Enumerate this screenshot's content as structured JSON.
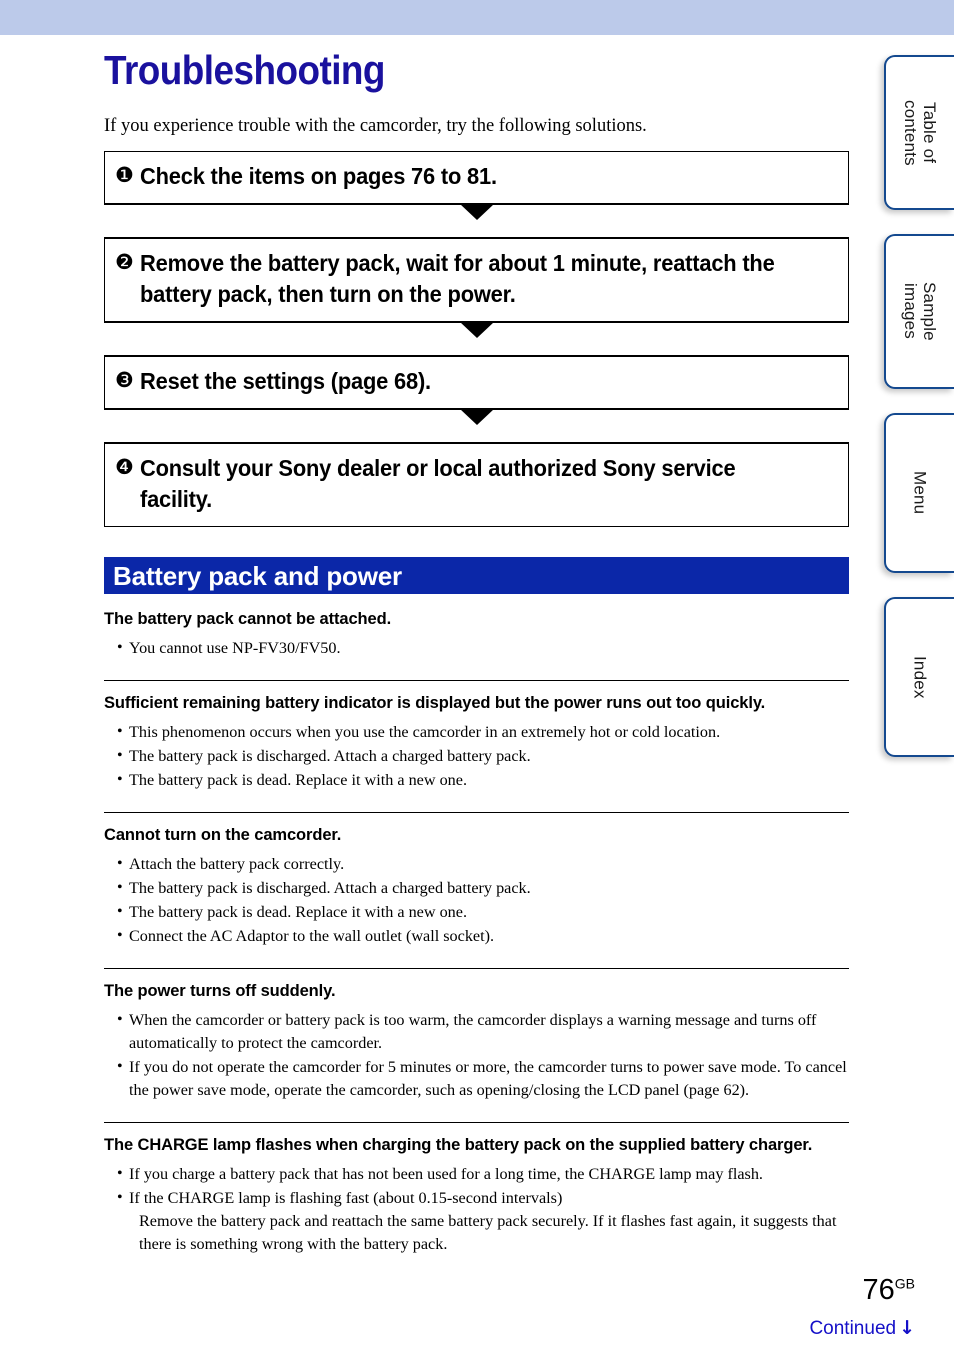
{
  "top_band_color": "#bccaea",
  "title_color": "#1a119e",
  "banner_color": "#0b27a8",
  "link_color": "#1510c8",
  "header": {
    "title": "Troubleshooting",
    "intro": "If you experience trouble with the camcorder, try the following solutions."
  },
  "steps": [
    {
      "num": "❶",
      "text": "Check the items on pages 76 to 81."
    },
    {
      "num": "❷",
      "text": "Remove the battery pack, wait for about 1 minute, reattach the battery pack, then turn on the power."
    },
    {
      "num": "❸",
      "text": "Reset the settings (page 68)."
    },
    {
      "num": "❹",
      "text": "Consult your Sony dealer or local authorized Sony service facility."
    }
  ],
  "section": {
    "banner_label": "Battery pack and power"
  },
  "qa_blocks": [
    {
      "heading": "The battery pack cannot be attached.",
      "items": [
        {
          "text": "You cannot use NP-FV30/FV50."
        }
      ]
    },
    {
      "heading": "Sufficient remaining battery indicator is displayed but the power runs out too quickly.",
      "items": [
        {
          "text": "This phenomenon occurs when you use the camcorder in an extremely hot or cold location."
        },
        {
          "text": "The battery pack is discharged. Attach a charged battery pack."
        },
        {
          "text": "The battery pack is dead. Replace it with a new one."
        }
      ]
    },
    {
      "heading": "Cannot turn on the camcorder.",
      "items": [
        {
          "text": "Attach the battery pack correctly."
        },
        {
          "text": "The battery pack is discharged. Attach a charged battery pack."
        },
        {
          "text": "The battery pack is dead. Replace it with a new one."
        },
        {
          "text": "Connect the AC Adaptor to the wall outlet (wall socket)."
        }
      ]
    },
    {
      "heading": "The power turns off suddenly.",
      "items": [
        {
          "text": "When the camcorder or battery pack is too warm, the camcorder displays a warning message and turns off automatically to protect the camcorder."
        },
        {
          "text": "If you do not operate the camcorder for 5 minutes or more, the camcorder turns to power save mode. To cancel the power save mode, operate the camcorder, such as opening/closing the LCD panel (page 62)."
        }
      ]
    },
    {
      "heading": "The CHARGE lamp flashes when charging the battery pack on the supplied battery charger.",
      "items": [
        {
          "text": "If you charge a battery pack that has not been used for a long time, the CHARGE lamp may flash."
        },
        {
          "text": "If the CHARGE lamp is flashing fast (about 0.15-second intervals)",
          "continuation": "Remove the battery pack and reattach the same battery pack securely. If it flashes fast again, it suggests that there is something wrong with the battery pack."
        }
      ]
    }
  ],
  "side_tabs": [
    {
      "label": "Table of\ncontents"
    },
    {
      "label": "Sample\nimages"
    },
    {
      "label": "Menu"
    },
    {
      "label": "Index"
    }
  ],
  "footer": {
    "page_number": "76",
    "page_suffix": "GB",
    "continued": "Continued",
    "continued_arrow": "↓"
  }
}
